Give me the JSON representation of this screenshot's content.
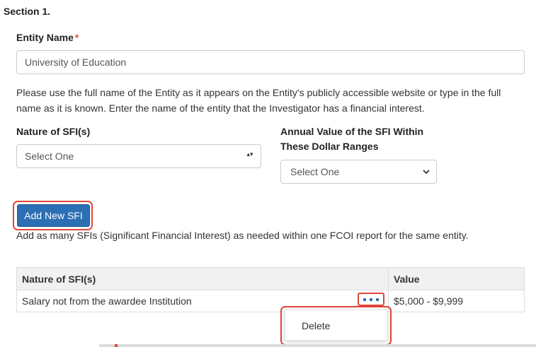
{
  "section": {
    "title": "Section 1."
  },
  "entity": {
    "label": "Entity Name",
    "required_marker": "*",
    "value": "University of Education",
    "help": "Please use the full name of the Entity as it appears on the Entity's publicly accessible website or type in the full name as it is known. Enter the name of the entity that the Investigator has a financial interest."
  },
  "nature": {
    "label": "Nature of SFI(s)",
    "selected": "Select One",
    "caret": "▴▾"
  },
  "annual": {
    "label_line1": "Annual Value of the SFI Within",
    "label_line2": "These Dollar Ranges",
    "selected": "Select One",
    "caret": "⌄"
  },
  "add_button": {
    "label": "Add New SFI"
  },
  "note": "Add as many SFIs (Significant Financial Interest) as needed within one FCOI report for the same entity.",
  "table": {
    "headers": {
      "nature": "Nature of SFI(s)",
      "value": "Value"
    },
    "rows": [
      {
        "nature": "Salary not from the awardee Institution",
        "value": "$5,000 - $9,999"
      }
    ]
  },
  "context_menu": {
    "items": [
      {
        "label": "Delete"
      }
    ]
  },
  "colors": {
    "primary": "#2b6fb4",
    "highlight": "#e0453a",
    "required": "#d9534f"
  }
}
